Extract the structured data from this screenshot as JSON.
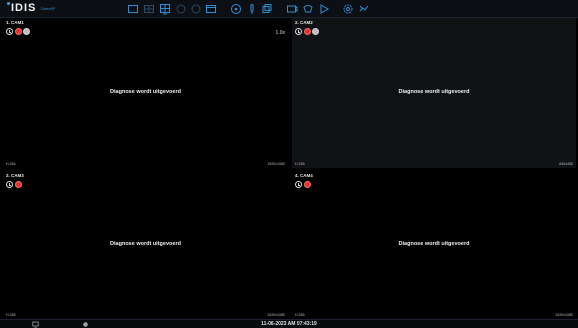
{
  "app": {
    "logo_text": "IDIS",
    "logo_sub": "DirectIP"
  },
  "toolbar": {
    "icons": [
      "layout-single-icon",
      "layout-quad-icon",
      "layout-grid-icon",
      "previous-group-icon",
      "next-group-icon",
      "sequence-icon",
      "ptz-icon",
      "audio-icon",
      "zoom-icon",
      "snapshot-icon",
      "alarm-icon",
      "playback-icon",
      "settings-icon",
      "network-icon"
    ]
  },
  "cameras": [
    {
      "title": "1. CAM1",
      "message": "Diagnose wordt uitgevoerd",
      "codec": "H.264",
      "resolution": "1920x1080",
      "zoom": "1.0x"
    },
    {
      "title": "2. CAM2",
      "message": "Diagnose wordt uitgevoerd",
      "codec": "H.265",
      "resolution": "640x480",
      "zoom": ""
    },
    {
      "title": "3. CAM3",
      "message": "Diagnose wordt uitgevoerd",
      "codec": "H.265",
      "resolution": "1920x1080",
      "zoom": ""
    },
    {
      "title": "4. CAM4",
      "message": "Diagnose wordt uitgevoerd",
      "codec": "H.265",
      "resolution": "1920x1080",
      "zoom": ""
    }
  ],
  "statusbar": {
    "datetime": "11-06-2023 AM 07:43:19"
  },
  "colors": {
    "accent": "#2fa4ff",
    "record": "#e53030",
    "panel": "#0c0f14"
  }
}
